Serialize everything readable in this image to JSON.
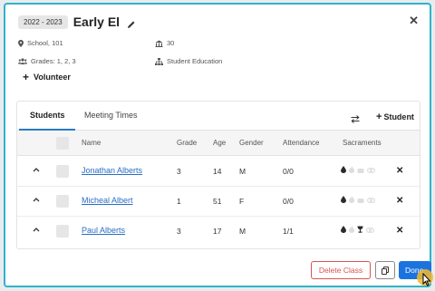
{
  "header": {
    "year": "2022 - 2023",
    "title": "Early El"
  },
  "info": {
    "location": "School, 101",
    "room": "30",
    "grades": "Grades: 1, 2, 3",
    "program": "Student Education",
    "volunteer_label": "Volunteer"
  },
  "tabs": [
    {
      "label": "Students",
      "active": true
    },
    {
      "label": "Meeting Times",
      "active": false
    }
  ],
  "add_student_label": "Student",
  "table": {
    "columns": [
      "Name",
      "Grade",
      "Age",
      "Gender",
      "Attendance",
      "Sacraments"
    ],
    "rows": [
      {
        "name": "Jonathan Alberts",
        "grade": "3",
        "age": "14",
        "gender": "M",
        "attendance": "0/0"
      },
      {
        "name": "Micheal Albert",
        "grade": "1",
        "age": "51",
        "gender": "F",
        "attendance": "0/0"
      },
      {
        "name": "Paul Alberts",
        "grade": "3",
        "age": "17",
        "gender": "M",
        "attendance": "1/1"
      }
    ]
  },
  "footer": {
    "delete_label": "Delete Class",
    "done_label": "Done"
  },
  "colors": {
    "accent": "#2fb3c9",
    "primary": "#1b73e0",
    "danger": "#d9534f",
    "link": "#2a6ec4"
  }
}
